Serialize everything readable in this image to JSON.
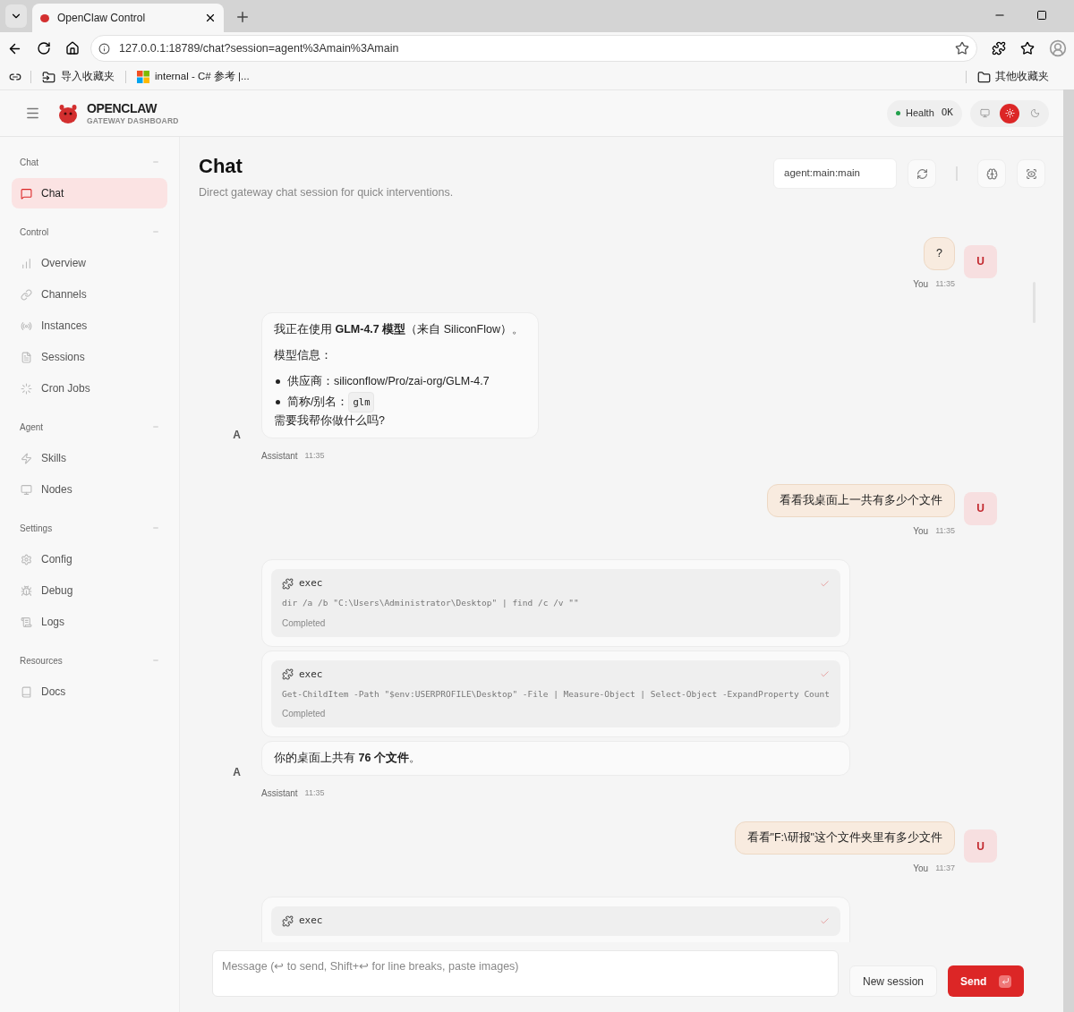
{
  "browser": {
    "tabs": [
      {
        "title": "OpenClaw Control",
        "selected": true
      }
    ],
    "url": "127.0.0.1:18789/chat?session=agent%3Amain%3Amain",
    "bookmarks": [
      {
        "label": "导入收藏夹"
      },
      {
        "label": "internal - C# 参考 |..."
      }
    ],
    "other_bookmarks": "其他收藏夹"
  },
  "header": {
    "brand": "OPENCLAW",
    "subtitle": "GATEWAY DASHBOARD",
    "health": {
      "label": "Health",
      "value": "OK"
    },
    "theme_modes": [
      {
        "kind": "system",
        "selected": false
      },
      {
        "kind": "light",
        "selected": true
      },
      {
        "kind": "dark",
        "selected": false
      }
    ]
  },
  "sidebar": {
    "groups": [
      {
        "title": "Chat",
        "items": [
          {
            "label": "Chat",
            "selected": true
          }
        ]
      },
      {
        "title": "Control",
        "items": [
          {
            "label": "Overview",
            "selected": false
          },
          {
            "label": "Channels",
            "selected": false
          },
          {
            "label": "Instances",
            "selected": false
          },
          {
            "label": "Sessions",
            "selected": false
          },
          {
            "label": "Cron Jobs",
            "selected": false
          }
        ]
      },
      {
        "title": "Agent",
        "items": [
          {
            "label": "Skills",
            "selected": false
          },
          {
            "label": "Nodes",
            "selected": false
          }
        ]
      },
      {
        "title": "Settings",
        "items": [
          {
            "label": "Config",
            "selected": false
          },
          {
            "label": "Debug",
            "selected": false
          },
          {
            "label": "Logs",
            "selected": false
          }
        ]
      },
      {
        "title": "Resources",
        "items": [
          {
            "label": "Docs",
            "selected": false
          }
        ]
      }
    ]
  },
  "page": {
    "title": "Chat",
    "subtitle": "Direct gateway chat session for quick interventions.",
    "session": "agent:main:main"
  },
  "messages": [
    {
      "kind": "user",
      "avatar": "U",
      "sender": "You",
      "time": "11:35",
      "cards": [
        {
          "kind": "text",
          "blocks": [
            {
              "kind": "paragraph",
              "text": "?"
            }
          ]
        }
      ]
    },
    {
      "kind": "assistant",
      "avatar": "A",
      "sender": "Assistant",
      "time": "11:35",
      "cards": [
        {
          "kind": "text",
          "blocks": [
            {
              "kind": "paragraph",
              "text": "我正在使用 **GLM-4.7 模型**（来自 SiliconFlow）。"
            },
            {
              "kind": "paragraph",
              "text": "模型信息："
            },
            {
              "kind": "bullets",
              "items": [
                {
                  "text": "供应商：siliconflow/Pro/zai-org/GLM-4.7"
                },
                {
                  "text": "简称/别名：",
                  "code": "glm"
                }
              ]
            },
            {
              "kind": "line",
              "text": "需要我帮你做什么吗?"
            }
          ]
        }
      ]
    },
    {
      "kind": "user",
      "avatar": "U",
      "sender": "You",
      "time": "11:35",
      "cards": [
        {
          "kind": "text",
          "blocks": [
            {
              "kind": "paragraph",
              "text": "看看我桌面上一共有多少个文件"
            }
          ]
        }
      ]
    },
    {
      "kind": "assistant",
      "avatar": "A",
      "sender": "Assistant",
      "time": "11:35",
      "cards": [
        {
          "kind": "tool",
          "name": "exec",
          "command": "dir /a /b \"C:\\Users\\Administrator\\Desktop\" | find /c /v \"\"",
          "status": "Completed",
          "done": true
        },
        {
          "kind": "tool",
          "name": "exec",
          "command": "Get-ChildItem -Path \"$env:USERPROFILE\\Desktop\" -File | Measure-Object | Select-Object -ExpandProperty Count",
          "status": "Completed",
          "done": true
        },
        {
          "kind": "text",
          "blocks": [
            {
              "kind": "paragraph",
              "text": "你的桌面上共有 **76 个文件**。"
            }
          ]
        }
      ]
    },
    {
      "kind": "user",
      "avatar": "U",
      "sender": "You",
      "time": "11:37",
      "cards": [
        {
          "kind": "text",
          "blocks": [
            {
              "kind": "paragraph",
              "text": "看看\"F:\\研报\"这个文件夹里有多少文件"
            }
          ]
        }
      ]
    },
    {
      "kind": "assistant",
      "cards": [
        {
          "kind": "tool",
          "name": "exec",
          "done": true
        }
      ]
    }
  ],
  "composer": {
    "placeholder": "Message (↩ to send, Shift+↩ for line breaks, paste images)",
    "buttons": [
      {
        "kind": "secondary",
        "label": "New session"
      },
      {
        "kind": "primary",
        "label": "Send"
      }
    ]
  }
}
